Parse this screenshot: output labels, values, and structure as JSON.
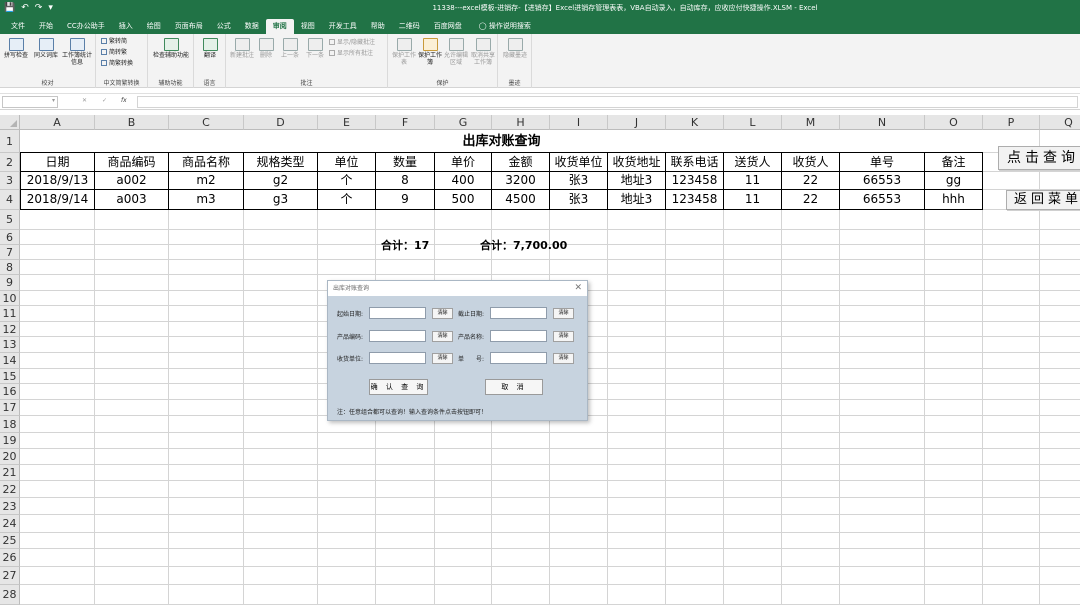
{
  "titlebar": {
    "qat_icons": [
      "save-icon",
      "undo-icon",
      "redo-icon",
      "customize-icon"
    ],
    "title": "11338---excel模板-进销存-【进销存】Excel进销存管理表表，VBA自动录入，自动库存，应收应付快捷操作.XLSM  -  Excel"
  },
  "tabs": [
    "文件",
    "开始",
    "CC办公助手",
    "插入",
    "绘图",
    "页面布局",
    "公式",
    "数据",
    "审阅",
    "视图",
    "开发工具",
    "帮助",
    "二维码",
    "百度网盘"
  ],
  "tab_active_index": 8,
  "tell_me": "操作说明搜索",
  "ribbon": {
    "proofing": {
      "label": "校对",
      "spell": "拼写检查",
      "thesaurus": "同义词库",
      "stats": "工作簿统计信息"
    },
    "chinese": {
      "label": "中文简繁转换",
      "to_simplified": "繁转简",
      "to_traditional": "简转繁",
      "convert": "简繁转换"
    },
    "accessibility": {
      "label": "辅助功能",
      "check": "检查辅助功能"
    },
    "language": {
      "label": "语言",
      "translate": "翻译"
    },
    "comments": {
      "label": "批注",
      "new": "新建批注",
      "delete": "删除",
      "prev": "上一条",
      "next": "下一条",
      "show_hide": "显示/隐藏批注",
      "show_all": "显示所有批注"
    },
    "protect": {
      "label": "保护",
      "sheet": "保护工作表",
      "workbook": "保护工作簿",
      "allow_ranges": "允许编辑区域",
      "unshare": "取消共享工作簿"
    },
    "ink": {
      "label": "墨迹",
      "hide_ink": "隐藏墨迹"
    }
  },
  "formula_bar": {
    "name_box": "",
    "cancel_icon": "✕",
    "enter_icon": "✓",
    "fx": "fx",
    "content": ""
  },
  "columns": [
    "A",
    "B",
    "C",
    "D",
    "E",
    "F",
    "G",
    "H",
    "I",
    "J",
    "K",
    "L",
    "M",
    "N",
    "O",
    "P",
    "Q"
  ],
  "sheet": {
    "title": "出库对账查询",
    "headers": [
      "日期",
      "商品编码",
      "商品名称",
      "规格类型",
      "单位",
      "数量",
      "单价",
      "金额",
      "收货单位",
      "收货地址",
      "联系电话",
      "送货人",
      "收货人",
      "单号",
      "备注"
    ],
    "rows": [
      [
        "2018/9/13",
        "a002",
        "m2",
        "g2",
        "个",
        "8",
        "400",
        "3200",
        "张3",
        "地址3",
        "123458",
        "11",
        "22",
        "66553",
        "gg"
      ],
      [
        "2018/9/14",
        "a003",
        "m3",
        "g3",
        "个",
        "9",
        "500",
        "4500",
        "张3",
        "地址3",
        "123458",
        "11",
        "22",
        "66553",
        "hhh"
      ]
    ],
    "total_qty": "合计：17",
    "total_amount": "合计：7,700.00",
    "btn_query": "点击查询",
    "btn_menu": "返回菜单"
  },
  "dialog": {
    "title": "出库对账查询",
    "close": "✕",
    "start_date": "起始日期:",
    "end_date": "截止日期:",
    "product_code": "产品编码:",
    "product_name": "产品名称:",
    "receiver": "收货单位:",
    "order_no": "单　　号:",
    "clear": "清除",
    "confirm": "确 认 查 询",
    "cancel": "取 消",
    "note": "注：任意组合都可以查询！输入查询条件点击按钮即可！"
  }
}
